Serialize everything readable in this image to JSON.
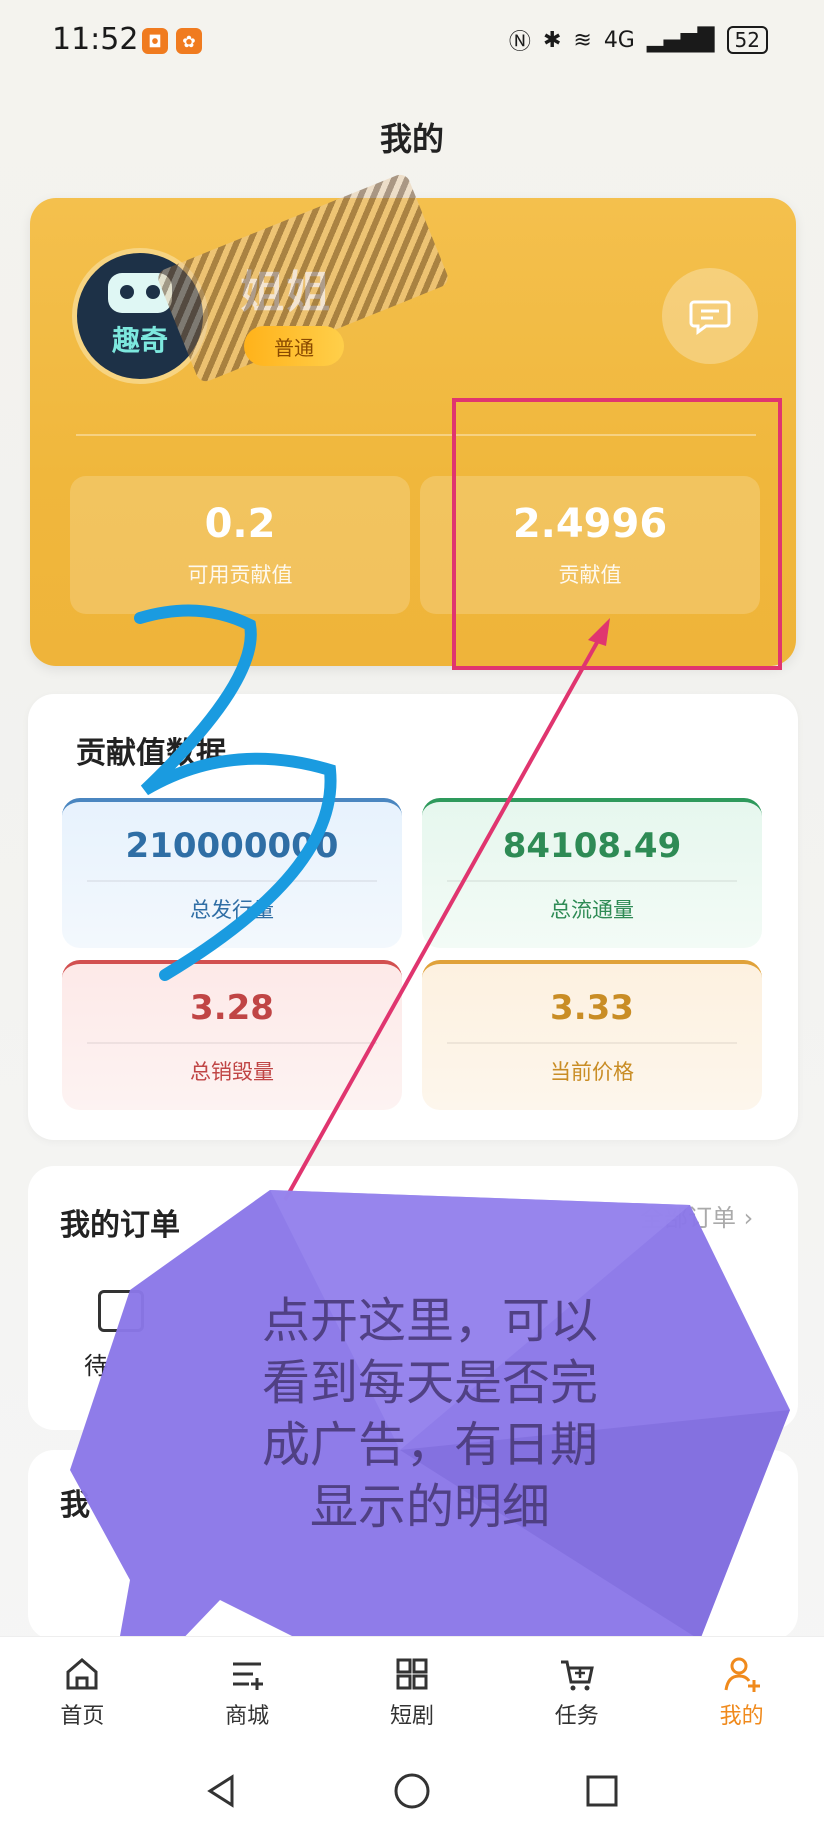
{
  "status_bar": {
    "time": "11:52",
    "network": "4G",
    "battery": "52"
  },
  "page": {
    "title": "我的"
  },
  "profile": {
    "avatar_text": "趣奇",
    "name": "姐姐",
    "level_badge": "普通",
    "stats": [
      {
        "value": "0.2",
        "label": "可用贡献值"
      },
      {
        "value": "2.4996",
        "label": "贡献值"
      }
    ]
  },
  "contribution": {
    "title": "贡献值数据",
    "metrics": [
      {
        "value": "210000000",
        "label": "总发行量"
      },
      {
        "value": "84108.49",
        "label": "总流通量"
      },
      {
        "value": "3.28",
        "label": "总销毁量"
      },
      {
        "value": "3.33",
        "label": "当前价格"
      }
    ]
  },
  "orders": {
    "title": "我的订单",
    "all_link": "全部订单",
    "partial_item": "待",
    "partial_section": "我"
  },
  "nav": [
    {
      "label": "首页",
      "icon": "home-icon"
    },
    {
      "label": "商城",
      "icon": "list-icon"
    },
    {
      "label": "短剧",
      "icon": "grid-icon"
    },
    {
      "label": "任务",
      "icon": "cart-icon"
    },
    {
      "label": "我的",
      "icon": "user-add-icon",
      "active": true
    }
  ],
  "annotation": {
    "bubble_lines": [
      "点开这里，可以",
      "看到每天是否完",
      "成广告，有日期",
      "显示的明细"
    ],
    "colors": {
      "highlight": "#e0356f",
      "bubble": "#8a77e8",
      "scribble": "#1a9be0"
    }
  }
}
